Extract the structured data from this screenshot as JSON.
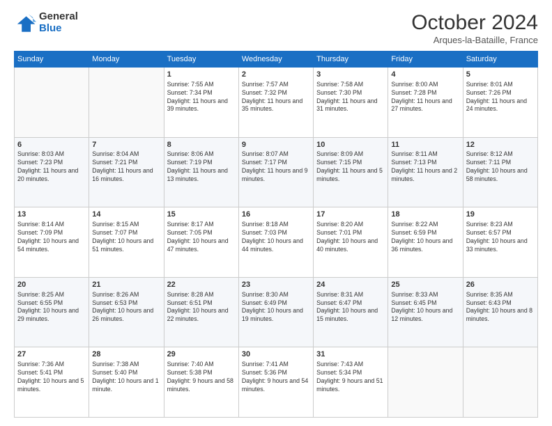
{
  "logo": {
    "general": "General",
    "blue": "Blue"
  },
  "title": "October 2024",
  "location": "Arques-la-Bataille, France",
  "days_of_week": [
    "Sunday",
    "Monday",
    "Tuesday",
    "Wednesday",
    "Thursday",
    "Friday",
    "Saturday"
  ],
  "weeks": [
    [
      {
        "day": "",
        "info": ""
      },
      {
        "day": "",
        "info": ""
      },
      {
        "day": "1",
        "sunrise": "Sunrise: 7:55 AM",
        "sunset": "Sunset: 7:34 PM",
        "daylight": "Daylight: 11 hours and 39 minutes."
      },
      {
        "day": "2",
        "sunrise": "Sunrise: 7:57 AM",
        "sunset": "Sunset: 7:32 PM",
        "daylight": "Daylight: 11 hours and 35 minutes."
      },
      {
        "day": "3",
        "sunrise": "Sunrise: 7:58 AM",
        "sunset": "Sunset: 7:30 PM",
        "daylight": "Daylight: 11 hours and 31 minutes."
      },
      {
        "day": "4",
        "sunrise": "Sunrise: 8:00 AM",
        "sunset": "Sunset: 7:28 PM",
        "daylight": "Daylight: 11 hours and 27 minutes."
      },
      {
        "day": "5",
        "sunrise": "Sunrise: 8:01 AM",
        "sunset": "Sunset: 7:26 PM",
        "daylight": "Daylight: 11 hours and 24 minutes."
      }
    ],
    [
      {
        "day": "6",
        "sunrise": "Sunrise: 8:03 AM",
        "sunset": "Sunset: 7:23 PM",
        "daylight": "Daylight: 11 hours and 20 minutes."
      },
      {
        "day": "7",
        "sunrise": "Sunrise: 8:04 AM",
        "sunset": "Sunset: 7:21 PM",
        "daylight": "Daylight: 11 hours and 16 minutes."
      },
      {
        "day": "8",
        "sunrise": "Sunrise: 8:06 AM",
        "sunset": "Sunset: 7:19 PM",
        "daylight": "Daylight: 11 hours and 13 minutes."
      },
      {
        "day": "9",
        "sunrise": "Sunrise: 8:07 AM",
        "sunset": "Sunset: 7:17 PM",
        "daylight": "Daylight: 11 hours and 9 minutes."
      },
      {
        "day": "10",
        "sunrise": "Sunrise: 8:09 AM",
        "sunset": "Sunset: 7:15 PM",
        "daylight": "Daylight: 11 hours and 5 minutes."
      },
      {
        "day": "11",
        "sunrise": "Sunrise: 8:11 AM",
        "sunset": "Sunset: 7:13 PM",
        "daylight": "Daylight: 11 hours and 2 minutes."
      },
      {
        "day": "12",
        "sunrise": "Sunrise: 8:12 AM",
        "sunset": "Sunset: 7:11 PM",
        "daylight": "Daylight: 10 hours and 58 minutes."
      }
    ],
    [
      {
        "day": "13",
        "sunrise": "Sunrise: 8:14 AM",
        "sunset": "Sunset: 7:09 PM",
        "daylight": "Daylight: 10 hours and 54 minutes."
      },
      {
        "day": "14",
        "sunrise": "Sunrise: 8:15 AM",
        "sunset": "Sunset: 7:07 PM",
        "daylight": "Daylight: 10 hours and 51 minutes."
      },
      {
        "day": "15",
        "sunrise": "Sunrise: 8:17 AM",
        "sunset": "Sunset: 7:05 PM",
        "daylight": "Daylight: 10 hours and 47 minutes."
      },
      {
        "day": "16",
        "sunrise": "Sunrise: 8:18 AM",
        "sunset": "Sunset: 7:03 PM",
        "daylight": "Daylight: 10 hours and 44 minutes."
      },
      {
        "day": "17",
        "sunrise": "Sunrise: 8:20 AM",
        "sunset": "Sunset: 7:01 PM",
        "daylight": "Daylight: 10 hours and 40 minutes."
      },
      {
        "day": "18",
        "sunrise": "Sunrise: 8:22 AM",
        "sunset": "Sunset: 6:59 PM",
        "daylight": "Daylight: 10 hours and 36 minutes."
      },
      {
        "day": "19",
        "sunrise": "Sunrise: 8:23 AM",
        "sunset": "Sunset: 6:57 PM",
        "daylight": "Daylight: 10 hours and 33 minutes."
      }
    ],
    [
      {
        "day": "20",
        "sunrise": "Sunrise: 8:25 AM",
        "sunset": "Sunset: 6:55 PM",
        "daylight": "Daylight: 10 hours and 29 minutes."
      },
      {
        "day": "21",
        "sunrise": "Sunrise: 8:26 AM",
        "sunset": "Sunset: 6:53 PM",
        "daylight": "Daylight: 10 hours and 26 minutes."
      },
      {
        "day": "22",
        "sunrise": "Sunrise: 8:28 AM",
        "sunset": "Sunset: 6:51 PM",
        "daylight": "Daylight: 10 hours and 22 minutes."
      },
      {
        "day": "23",
        "sunrise": "Sunrise: 8:30 AM",
        "sunset": "Sunset: 6:49 PM",
        "daylight": "Daylight: 10 hours and 19 minutes."
      },
      {
        "day": "24",
        "sunrise": "Sunrise: 8:31 AM",
        "sunset": "Sunset: 6:47 PM",
        "daylight": "Daylight: 10 hours and 15 minutes."
      },
      {
        "day": "25",
        "sunrise": "Sunrise: 8:33 AM",
        "sunset": "Sunset: 6:45 PM",
        "daylight": "Daylight: 10 hours and 12 minutes."
      },
      {
        "day": "26",
        "sunrise": "Sunrise: 8:35 AM",
        "sunset": "Sunset: 6:43 PM",
        "daylight": "Daylight: 10 hours and 8 minutes."
      }
    ],
    [
      {
        "day": "27",
        "sunrise": "Sunrise: 7:36 AM",
        "sunset": "Sunset: 5:41 PM",
        "daylight": "Daylight: 10 hours and 5 minutes."
      },
      {
        "day": "28",
        "sunrise": "Sunrise: 7:38 AM",
        "sunset": "Sunset: 5:40 PM",
        "daylight": "Daylight: 10 hours and 1 minute."
      },
      {
        "day": "29",
        "sunrise": "Sunrise: 7:40 AM",
        "sunset": "Sunset: 5:38 PM",
        "daylight": "Daylight: 9 hours and 58 minutes."
      },
      {
        "day": "30",
        "sunrise": "Sunrise: 7:41 AM",
        "sunset": "Sunset: 5:36 PM",
        "daylight": "Daylight: 9 hours and 54 minutes."
      },
      {
        "day": "31",
        "sunrise": "Sunrise: 7:43 AM",
        "sunset": "Sunset: 5:34 PM",
        "daylight": "Daylight: 9 hours and 51 minutes."
      },
      {
        "day": "",
        "info": ""
      },
      {
        "day": "",
        "info": ""
      }
    ]
  ]
}
